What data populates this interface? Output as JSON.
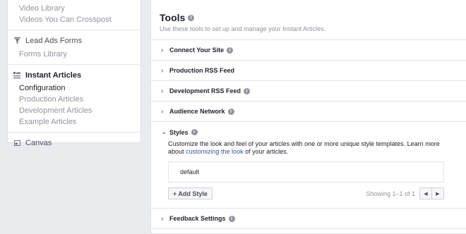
{
  "sidebar": {
    "top_links": [
      "Video Library",
      "Videos You Can Crosspost"
    ],
    "lead_ads": {
      "label": "Lead Ads Forms",
      "icon": "funnel-icon",
      "items": [
        "Forms Library"
      ]
    },
    "instant_articles": {
      "label": "Instant Articles",
      "icon": "articles-icon",
      "items": [
        "Configuration",
        "Production Articles",
        "Development Articles",
        "Example Articles"
      ]
    },
    "canvas": {
      "label": "Canvas",
      "icon": "canvas-icon"
    }
  },
  "main": {
    "title": "Tools",
    "subtitle": "Use these tools to set up and manage your Instant Articles.",
    "rows": {
      "connect": "Connect Your Site",
      "production_rss": "Production RSS Feed",
      "development_rss": "Development RSS Feed",
      "audience_network": "Audience Network",
      "feedback": "Feedback Settings"
    },
    "styles": {
      "label": "Styles",
      "desc_before": "Customize the look and feel of your articles with one or more unique style templates. Learn more about ",
      "desc_link": "customizing the look",
      "desc_after": " of your articles.",
      "items": [
        "default"
      ],
      "add_button": "+ Add Style",
      "showing": "Showing 1–1 of 1",
      "prev": "◀",
      "next": "▶"
    }
  },
  "colors": {
    "link": "#365899",
    "muted": "#90949c",
    "text": "#1d2129"
  }
}
